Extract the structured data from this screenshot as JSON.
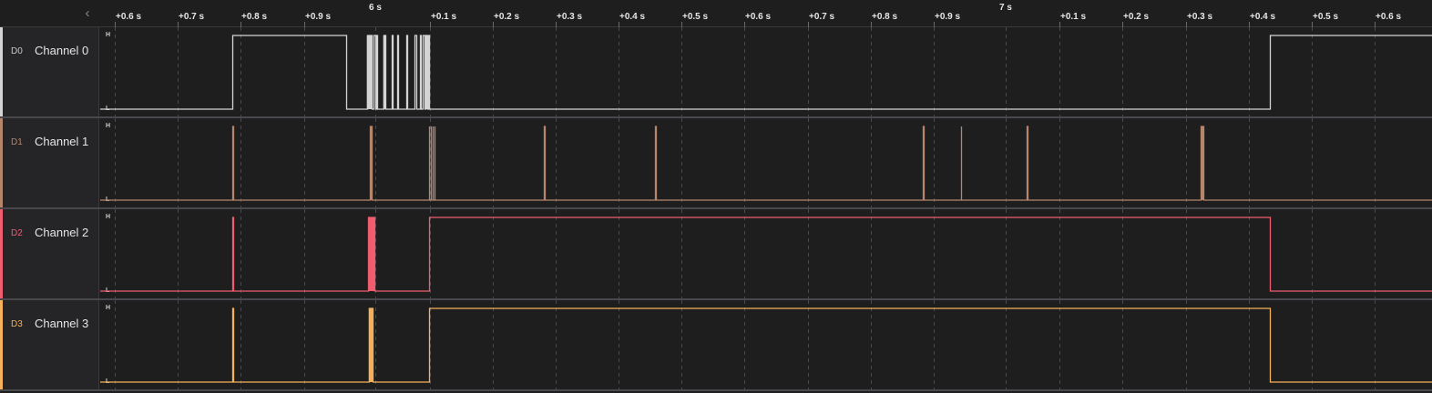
{
  "ruler": {
    "labels": [
      "+0.6 s",
      "+0.7 s",
      "+0.8 s",
      "+0.9 s",
      "+0.1 s",
      "+0.2 s",
      "+0.3 s",
      "+0.4 s",
      "+0.5 s",
      "+0.6 s",
      "+0.7 s",
      "+0.8 s",
      "+0.9 s",
      "+0.1 s",
      "+0.2 s",
      "+0.3 s",
      "+0.4 s",
      "+0.5 s",
      "+0.6 s"
    ],
    "major": [
      "6 s",
      "7 s"
    ],
    "collapse_icon": "chevron-left-icon"
  },
  "level_labels": {
    "high": "H",
    "low": "L"
  },
  "chart_data": {
    "type": "digital-timing",
    "time_unit": "s",
    "x_range": [
      5.55,
      6.66
    ],
    "channels": [
      {
        "id": "D0",
        "name": "Channel 0",
        "color": "#d4d4d4",
        "initial": 0,
        "edges": [
          5.76,
          5.94,
          5.973,
          5.981,
          5.984,
          5.986,
          5.988,
          5.99,
          5.999,
          6.003,
          6.012,
          6.014,
          6.021,
          6.023,
          6.035,
          6.037,
          6.049,
          6.051,
          6.057,
          6.059,
          6.062,
          6.064,
          6.066,
          6.067,
          6.068,
          6.069,
          6.07,
          6.071,
          7.405
        ]
      },
      {
        "id": "D1",
        "name": "Channel 1",
        "color": "#b5866b",
        "initial": 0,
        "edges": [
          5.76,
          5.761,
          5.978,
          5.981,
          6.071,
          6.072,
          6.074,
          6.075,
          6.077,
          6.078,
          6.08,
          6.081,
          6.254,
          6.255,
          6.43,
          6.431,
          6.855,
          6.856,
          6.915,
          6.916,
          7.02,
          7.021,
          7.296,
          7.3
        ]
      },
      {
        "id": "D2",
        "name": "Channel 2",
        "color": "#f05d6f",
        "initial": 0,
        "edges": [
          5.76,
          5.761,
          5.975,
          5.985,
          6.072,
          7.405
        ]
      },
      {
        "id": "D3",
        "name": "Channel 3",
        "color": "#f7b15a",
        "initial": 0,
        "edges": [
          5.76,
          5.761,
          5.976,
          5.982,
          6.072,
          7.405
        ]
      }
    ]
  }
}
